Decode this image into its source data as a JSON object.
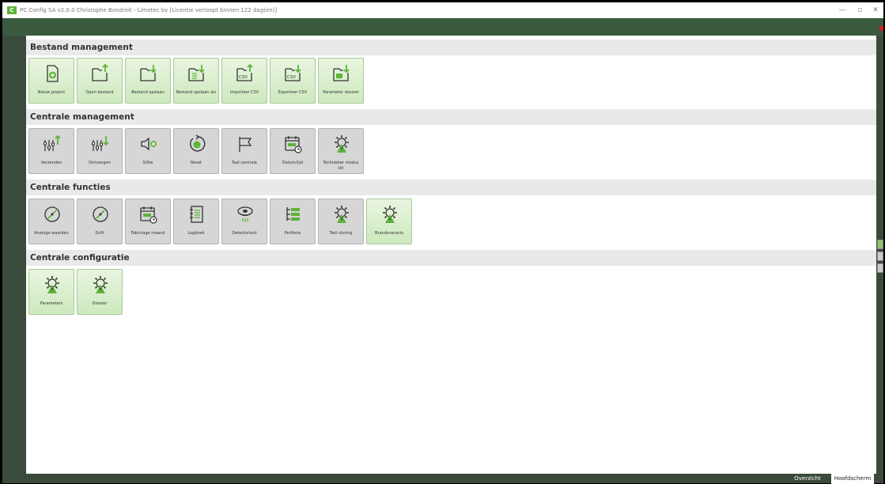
{
  "window": {
    "app_icon_text": "C",
    "title": "PC Config SA v2.0.0 Christophe Bondroit - Limotec bv [Licentie verloopt binnen 122 dag(en)]",
    "controls": [
      "—",
      "▫",
      "✕"
    ]
  },
  "sections": [
    {
      "title": "Bestand management",
      "tiles": [
        {
          "label": "Nieuw project",
          "icon": "new-file-icon",
          "style": "green"
        },
        {
          "label": "Open bestand",
          "icon": "folder-up-icon",
          "style": "green"
        },
        {
          "label": "Bestand opslaan",
          "icon": "folder-down-icon",
          "style": "green"
        },
        {
          "label": "Bestand opslaan als",
          "icon": "folder-save-as-icon",
          "style": "green"
        },
        {
          "label": "Importeer CSV",
          "icon": "csv-import-icon",
          "style": "green"
        },
        {
          "label": "Exporteer CSV",
          "icon": "csv-export-icon",
          "style": "green"
        },
        {
          "label": "Parameter dossier",
          "icon": "parameter-dossier-icon",
          "style": "green"
        }
      ]
    },
    {
      "title": "Centrale management",
      "tiles": [
        {
          "label": "Verzenden",
          "icon": "send-icon",
          "style": "grey"
        },
        {
          "label": "Ontvangen",
          "icon": "receive-icon",
          "style": "grey"
        },
        {
          "label": "Stilte",
          "icon": "silence-icon",
          "style": "grey"
        },
        {
          "label": "Reset",
          "icon": "reset-icon",
          "style": "grey"
        },
        {
          "label": "Taal centrale",
          "icon": "flag-icon",
          "style": "grey"
        },
        {
          "label": "Datum/tijd",
          "icon": "calendar-clock-icon",
          "style": "grey"
        },
        {
          "label": "Technieker modus Uit",
          "icon": "gear-warning-icon",
          "style": "grey"
        }
      ]
    },
    {
      "title": "Centrale functies",
      "tiles": [
        {
          "label": "Analoge waarden",
          "icon": "gauge-icon",
          "style": "grey"
        },
        {
          "label": "Drift",
          "icon": "gauge-icon",
          "style": "grey"
        },
        {
          "label": "Fabricage maand",
          "icon": "calendar-clock-icon",
          "style": "grey"
        },
        {
          "label": "Logboek",
          "icon": "logbook-icon",
          "style": "grey"
        },
        {
          "label": "Detectortest",
          "icon": "detector-icon",
          "style": "grey"
        },
        {
          "label": "Periferie",
          "icon": "tree-list-icon",
          "style": "grey"
        },
        {
          "label": "Test sturing",
          "icon": "gear-warning-icon",
          "style": "grey"
        },
        {
          "label": "Brandscenario",
          "icon": "gear-warning-icon",
          "style": "green"
        }
      ]
    },
    {
      "title": "Centrale configuratie",
      "tiles": [
        {
          "label": "Parameters",
          "icon": "gear-warning-icon",
          "style": "green"
        },
        {
          "label": "Dossier",
          "icon": "gear-warning-icon",
          "style": "green"
        }
      ]
    }
  ],
  "bottom_tabs": {
    "overzicht": "Overzicht",
    "hoofdscherm": "Hoofdscherm"
  },
  "colors": {
    "accent": "#5db33b",
    "frame": "#3b4b3b",
    "tile_green": "#cde9bd",
    "tile_grey": "#d6d6d6"
  }
}
